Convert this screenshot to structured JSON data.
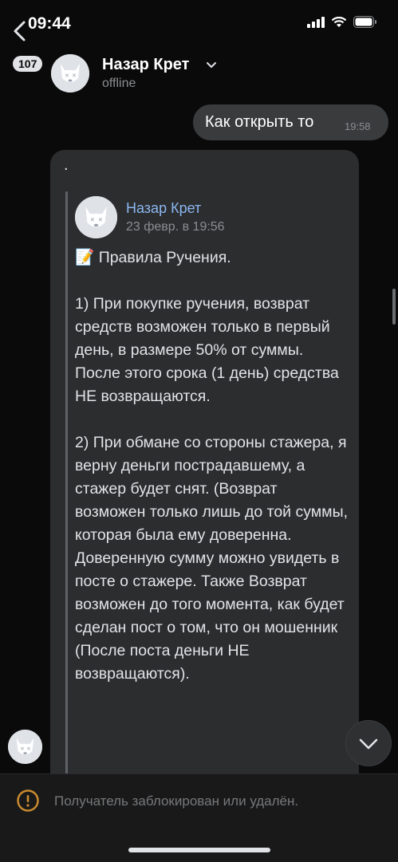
{
  "status_bar": {
    "time": "09:44"
  },
  "header": {
    "back_badge": "107",
    "contact_name": "Назар Крет",
    "contact_status": "offline"
  },
  "messages": {
    "outgoing": {
      "text": "Как открыть то",
      "time": "19:58"
    },
    "incoming": {
      "text": ".",
      "forwarded": {
        "author": "Назар Крет",
        "date": "23 февр. в 19:56",
        "text": "📝 Правила Ручения.\n\n1) При покупке ручения, возврат средств возможен только в первый день, в размере 50% от суммы. После этого срока (1 день) средства НЕ возвращаются.\n\n2) При обмане со стороны стажера, я верну деньги пострадавшему, а стажер будет снят. (Возврат возможен только лишь до той суммы, которая была ему доверенна. Доверенную сумму можно увидеть в посте о стажере. Также Возврат возможен до того момента, как будет сделан пост о том, что он мошенник (После поста деньги НЕ возвращаются)."
      }
    }
  },
  "footer": {
    "blocked_text": "Получатель заблокирован или удалён."
  },
  "icons": {
    "back": "chevron-left-icon",
    "dropdown": "chevron-down-icon",
    "scroll": "chevron-down-icon",
    "warning": "exclamation-circle-icon"
  },
  "colors": {
    "background": "#0a0a0a",
    "bubble_out": "#3a3b3d",
    "bubble_in": "#2c2d2f",
    "link": "#8bb7f0",
    "warning": "#c98a2e"
  }
}
